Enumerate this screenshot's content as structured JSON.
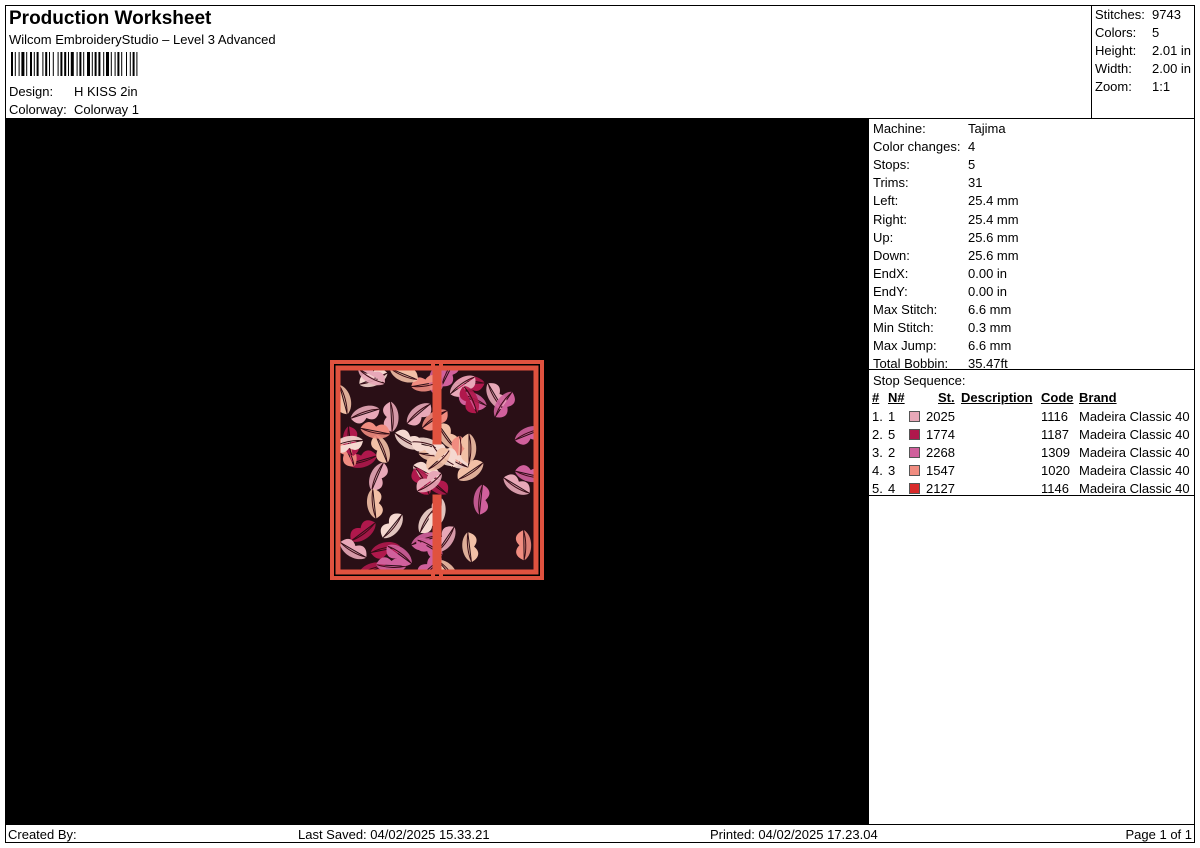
{
  "header": {
    "title": "Production Worksheet",
    "software": "Wilcom EmbroideryStudio – Level 3 Advanced",
    "design_label": "Design:",
    "design_value": "H KISS 2in",
    "colorway_label": "Colorway:",
    "colorway_value": "Colorway 1"
  },
  "summary": {
    "stitches_label": "Stitches:",
    "stitches": "9743",
    "colors_label": "Colors:",
    "colors": "5",
    "height_label": "Height:",
    "height": "2.01 in",
    "width_label": "Width:",
    "width": "2.00 in",
    "zoom_label": "Zoom:",
    "zoom": "1:1"
  },
  "machine_stats": [
    {
      "label": "Machine:",
      "value": "Tajima"
    },
    {
      "label": "Color changes:",
      "value": "4"
    },
    {
      "label": "Stops:",
      "value": "5"
    },
    {
      "label": "Trims:",
      "value": "31"
    },
    {
      "label": "Left:",
      "value": "25.4 mm"
    },
    {
      "label": "Right:",
      "value": "25.4 mm"
    },
    {
      "label": "Up:",
      "value": "25.6 mm"
    },
    {
      "label": "Down:",
      "value": "25.6 mm"
    },
    {
      "label": "EndX:",
      "value": "0.00 in"
    },
    {
      "label": "EndY:",
      "value": "0.00 in"
    },
    {
      "label": "Max Stitch:",
      "value": "6.6 mm"
    },
    {
      "label": "Min Stitch:",
      "value": "0.3 mm"
    },
    {
      "label": "Max Jump:",
      "value": "6.6 mm"
    },
    {
      "label": "Total Bobbin:",
      "value": "35.47ft"
    }
  ],
  "stop_sequence": {
    "title": "Stop Sequence:",
    "headers": {
      "num": "#",
      "n": "N#",
      "st": "St.",
      "description": "Description",
      "code": "Code",
      "brand": "Brand"
    },
    "rows": [
      {
        "num": "1.",
        "n": "1",
        "color": "#E8A8B8",
        "st": "2025",
        "description": "",
        "code": "1116",
        "brand": "Madeira Classic 40"
      },
      {
        "num": "2.",
        "n": "5",
        "color": "#B0184C",
        "st": "1774",
        "description": "",
        "code": "1187",
        "brand": "Madeira Classic 40"
      },
      {
        "num": "3.",
        "n": "2",
        "color": "#D0609C",
        "st": "2268",
        "description": "",
        "code": "1309",
        "brand": "Madeira Classic 40"
      },
      {
        "num": "4.",
        "n": "3",
        "color": "#F08C80",
        "st": "1547",
        "description": "",
        "code": "1020",
        "brand": "Madeira Classic 40"
      },
      {
        "num": "5.",
        "n": "4",
        "color": "#D82A2A",
        "st": "2127",
        "description": "",
        "code": "1146",
        "brand": "Madeira Classic 40"
      }
    ]
  },
  "footer": {
    "created_by": "Created By:",
    "last_saved": "Last Saved: 04/02/2025 15.33.21",
    "printed": "Printed: 04/02/2025 17.23.04",
    "page": "Page 1 of 1"
  },
  "preview_colors": {
    "background": "#000000",
    "outline": "#E0523F",
    "inner_outline": "#C23A30",
    "fill": "#2A0F16",
    "lip_colors": [
      "#E8A8B8",
      "#B0184C",
      "#D0609C",
      "#F08C80",
      "#F2C0A6",
      "#F5D8D0"
    ]
  }
}
